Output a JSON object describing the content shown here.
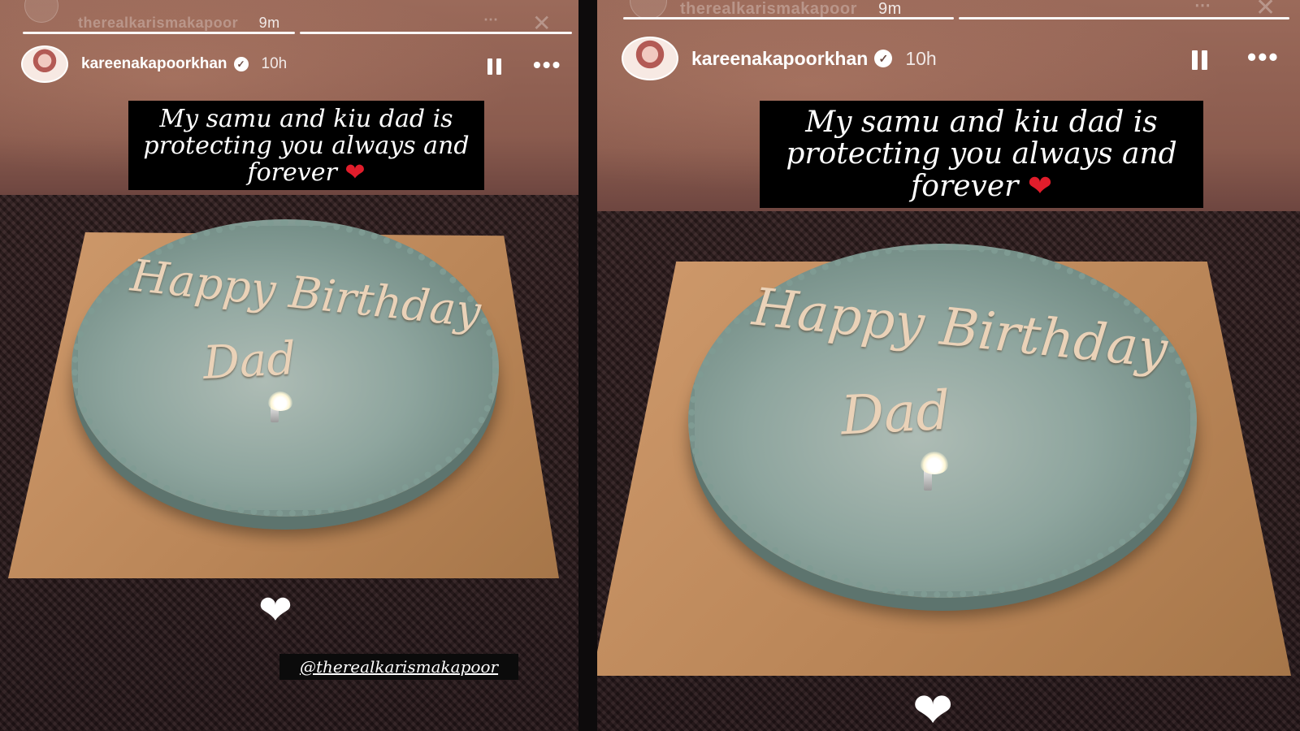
{
  "stories": [
    {
      "background_account": "therealkarismakapoor",
      "background_time": "9m",
      "username": "kareenakapoorkhan",
      "time_ago": "10h",
      "caption_lines": [
        "My samu and kiu dad is",
        "protecting you always and",
        "forever"
      ],
      "caption_emoji": "❤",
      "cake_line1": "Happy Birthday",
      "cake_line2": "Dad",
      "mention": "@therealkarismakapoor"
    },
    {
      "background_account": "therealkarismakapoor",
      "background_time": "9m",
      "username": "kareenakapoorkhan",
      "time_ago": "10h",
      "caption_lines": [
        "My samu and kiu dad is",
        "protecting you always and",
        "forever"
      ],
      "caption_emoji": "❤",
      "cake_line1": "Happy Birthday",
      "cake_line2": "Dad"
    }
  ],
  "icons": {
    "verified": "verified-badge-icon",
    "pause": "pause-icon",
    "more": "more-options-icon",
    "like": "heart-icon",
    "close": "close-icon"
  }
}
